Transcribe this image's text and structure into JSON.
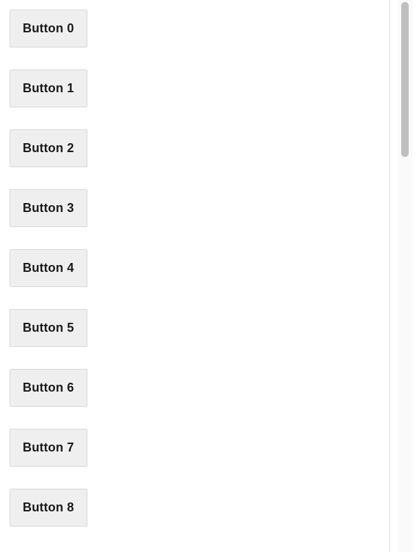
{
  "buttons": [
    {
      "label": "Button 0"
    },
    {
      "label": "Button 1"
    },
    {
      "label": "Button 2"
    },
    {
      "label": "Button 3"
    },
    {
      "label": "Button 4"
    },
    {
      "label": "Button 5"
    },
    {
      "label": "Button 6"
    },
    {
      "label": "Button 7"
    },
    {
      "label": "Button 8"
    }
  ]
}
